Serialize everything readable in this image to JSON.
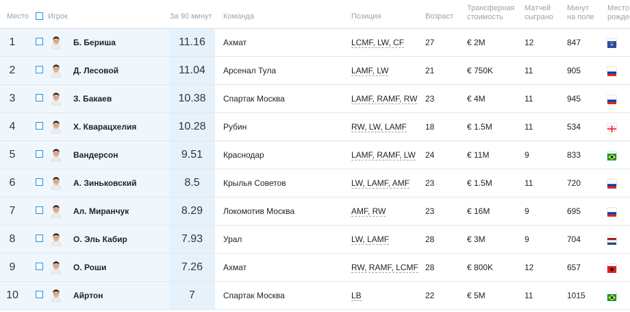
{
  "header": {
    "rank": "Место",
    "player": "Игрок",
    "per90": "За 90 минут",
    "team": "Команда",
    "position": "Позиция",
    "age": "Возраст",
    "value_line1": "Трансферная",
    "value_line2": "стоимость",
    "matches_line1": "Матчей",
    "matches_line2": "сыграно",
    "minutes_line1": "Минут",
    "minutes_line2": "на поле",
    "birth_line1": "Место",
    "birth_line2": "рожден"
  },
  "rows": [
    {
      "rank": "1",
      "name": "Б. Бериша",
      "per90": "11.16",
      "team": "Ахмат",
      "positions": "LCMF, LW, CF",
      "age": "27",
      "value": "€ 2M",
      "matches": "12",
      "minutes": "847",
      "flag": "kosovo"
    },
    {
      "rank": "2",
      "name": "Д. Лесовой",
      "per90": "11.04",
      "team": "Арсенал Тула",
      "positions": "LAMF, LW",
      "age": "21",
      "value": "€ 750K",
      "matches": "11",
      "minutes": "905",
      "flag": "russia"
    },
    {
      "rank": "3",
      "name": "З. Бакаев",
      "per90": "10.38",
      "team": "Спартак Москва",
      "positions": "LAMF, RAMF, RW",
      "age": "23",
      "value": "€ 4M",
      "matches": "11",
      "minutes": "945",
      "flag": "russia"
    },
    {
      "rank": "4",
      "name": "Х. Кварацхелия",
      "per90": "10.28",
      "team": "Рубин",
      "positions": "RW, LW, LAMF",
      "age": "18",
      "value": "€ 1.5M",
      "matches": "11",
      "minutes": "534",
      "flag": "georgia"
    },
    {
      "rank": "5",
      "name": "Вандерсон",
      "per90": "9.51",
      "team": "Краснодар",
      "positions": "LAMF, RAMF, LW",
      "age": "24",
      "value": "€ 11M",
      "matches": "9",
      "minutes": "833",
      "flag": "brazil"
    },
    {
      "rank": "6",
      "name": "А. Зиньковский",
      "per90": "8.5",
      "team": "Крылья Советов",
      "positions": "LW, LAMF, AMF",
      "age": "23",
      "value": "€ 1.5M",
      "matches": "11",
      "minutes": "720",
      "flag": "russia"
    },
    {
      "rank": "7",
      "name": "Ал. Миранчук",
      "per90": "8.29",
      "team": "Локомотив Москва",
      "positions": "AMF, RW",
      "age": "23",
      "value": "€ 16M",
      "matches": "9",
      "minutes": "695",
      "flag": "russia"
    },
    {
      "rank": "8",
      "name": "О. Эль Кабир",
      "per90": "7.93",
      "team": "Урал",
      "positions": "LW, LAMF",
      "age": "28",
      "value": "€ 3M",
      "matches": "9",
      "minutes": "704",
      "flag": "netherlands"
    },
    {
      "rank": "9",
      "name": "О. Роши",
      "per90": "7.26",
      "team": "Ахмат",
      "positions": "RW, RAMF, LCMF",
      "age": "28",
      "value": "€ 800K",
      "matches": "12",
      "minutes": "657",
      "flag": "albania"
    },
    {
      "rank": "10",
      "name": "Айртон",
      "per90": "7",
      "team": "Спартак Москва",
      "positions": "LB",
      "age": "22",
      "value": "€ 5M",
      "matches": "11",
      "minutes": "1015",
      "flag": "brazil"
    }
  ],
  "colors": {
    "accent": "#1a8fe3",
    "highlight": "#e6f2fb",
    "row_bg": "#f0f7fc"
  }
}
